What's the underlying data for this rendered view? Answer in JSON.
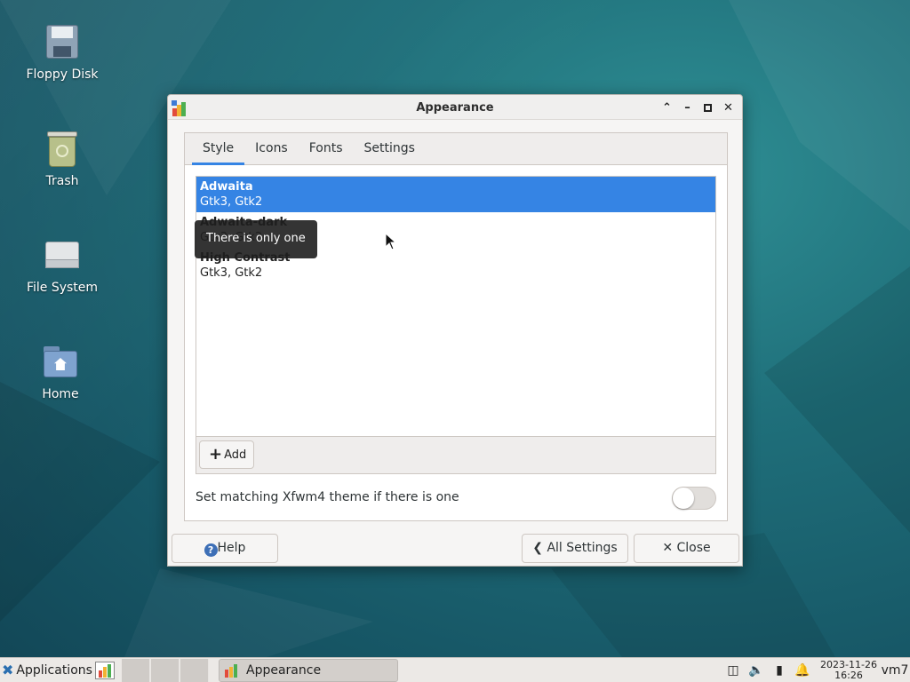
{
  "desktop": {
    "icons": [
      {
        "label": "Floppy Disk"
      },
      {
        "label": "Trash"
      },
      {
        "label": "File System"
      },
      {
        "label": "Home"
      }
    ]
  },
  "window": {
    "title": "Appearance",
    "tabs": [
      "Style",
      "Icons",
      "Fonts",
      "Settings"
    ],
    "active_tab": "Style",
    "themes": [
      {
        "name": "Adwaita",
        "types": "Gtk3, Gtk2",
        "selected": true
      },
      {
        "name": "Adwaita-dark",
        "types": "Gtk3, Gtk2",
        "selected": false
      },
      {
        "name": "High Contrast",
        "types": "Gtk3, Gtk2",
        "selected": false
      }
    ],
    "add_label": "Add",
    "tooltip": "There is only one",
    "match_label": "Set matching Xfwm4 theme if there is one",
    "match_enabled": false,
    "help_label": "Help",
    "all_settings_label": "All Settings",
    "close_label": "Close"
  },
  "taskbar": {
    "applications_label": "Applications",
    "task_label": "Appearance",
    "date": "2023-11-26",
    "time": "16:26",
    "user": "vm7"
  },
  "colors": {
    "accent": "#3584e4",
    "taskbar": "#ece9e6"
  }
}
